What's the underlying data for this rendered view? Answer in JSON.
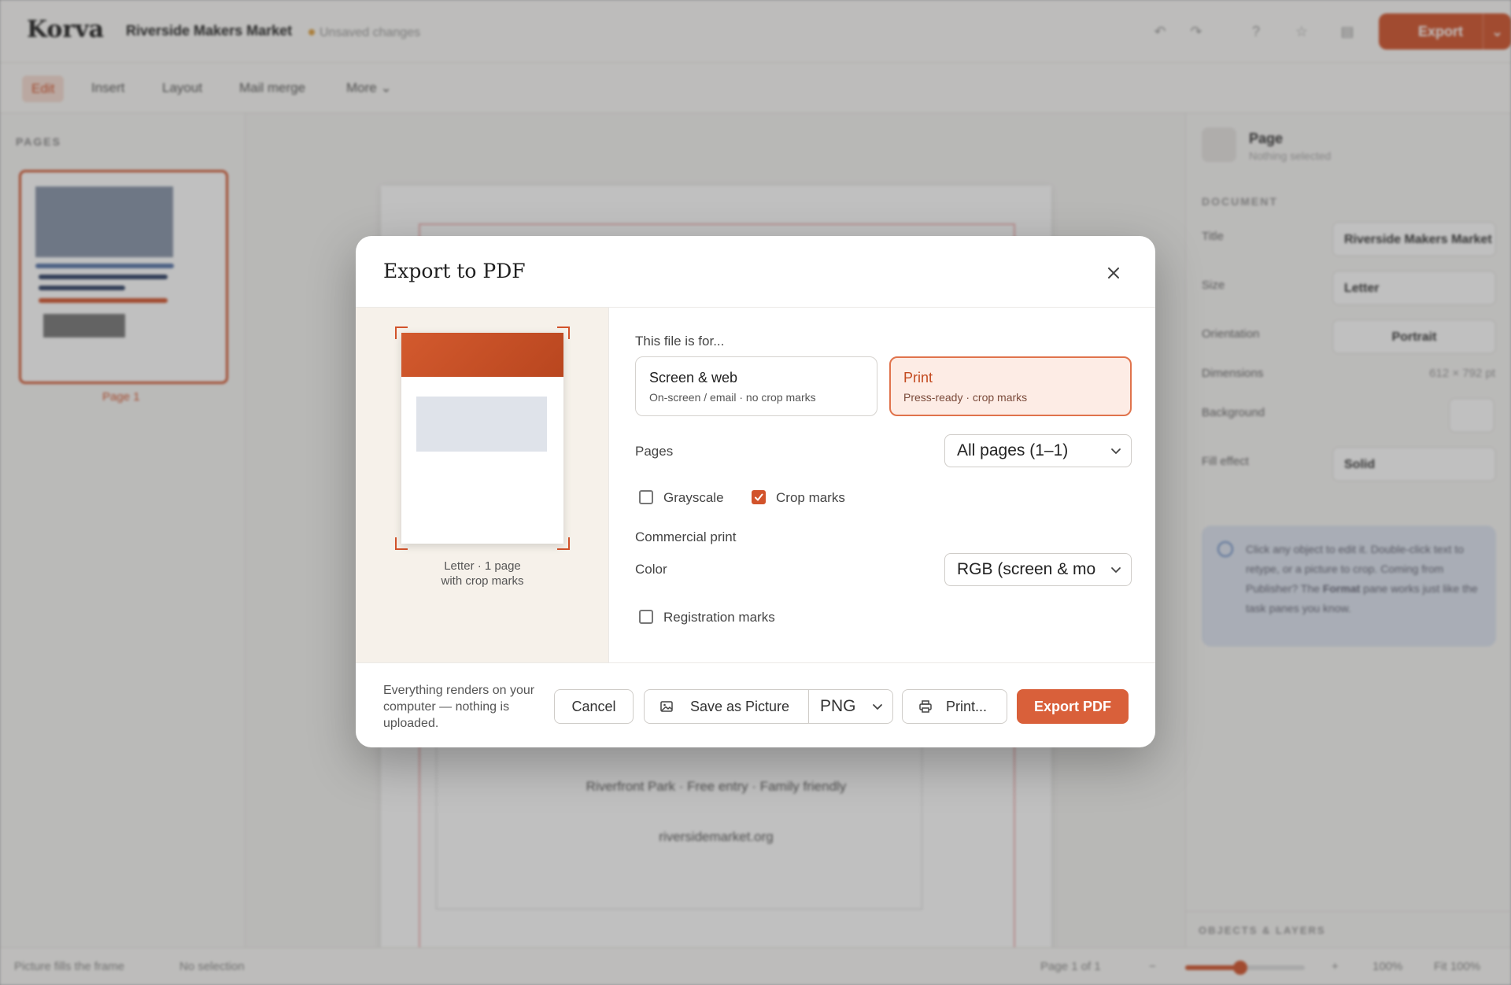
{
  "app": {
    "logo": "Korva",
    "document_title": "Riverside Makers Market",
    "unsaved": "Unsaved changes",
    "export_label": "Export"
  },
  "tabs": [
    {
      "label": "Edit"
    },
    {
      "label": "Insert"
    },
    {
      "label": "Layout"
    },
    {
      "label": "Mail merge"
    },
    {
      "label": "More"
    }
  ],
  "pages_panel": {
    "label": "PAGES",
    "thumb_label": "Page 1"
  },
  "canvas": {
    "line1": "Riverfront Park · Free entry · Family friendly",
    "line2": "riversidemarket.org"
  },
  "right_panel": {
    "title": "Page",
    "subtitle": "Nothing selected",
    "section": "DOCUMENT",
    "fields": {
      "title_label": "Title",
      "title_value": "Riverside Makers Market",
      "size_label": "Size",
      "size_value": "Letter",
      "orientation_label": "Orientation",
      "orientation_value": "Portrait",
      "dimensions_label": "Dimensions",
      "dimensions_value": "612 × 792 pt",
      "background_label": "Background",
      "fill_label": "Fill effect",
      "fill_value": "Solid"
    },
    "hint": {
      "before": "Click any object to edit it. Double-click text to retype, or a picture to crop. Coming from Publisher? The ",
      "bold": "Format",
      "after": " pane works just like the task panes you know."
    },
    "objects_label": "OBJECTS & LAYERS"
  },
  "status_bar": {
    "left": "Picture fills the frame",
    "selection": "No selection",
    "page": "Page 1 of 1",
    "zoom": "100%",
    "zoom_fraction": 0.46,
    "fit": "Fit 100%"
  },
  "dialog": {
    "title": "Export to PDF",
    "preview_caption_1": "Letter · 1 page",
    "preview_caption_2": "with crop marks",
    "purpose_label": "This file is for...",
    "purposes": [
      {
        "title": "Screen & web",
        "subtitle": "On-screen / email · no crop marks",
        "selected": false
      },
      {
        "title": "Print",
        "subtitle": "Press-ready · crop marks",
        "selected": true
      }
    ],
    "pages_label": "Pages",
    "pages_value": "All pages (1–1)",
    "grayscale_label": "Grayscale",
    "grayscale_checked": false,
    "crop_marks_label": "Crop marks",
    "crop_marks_checked": true,
    "commercial_label": "Commercial print",
    "color_label": "Color",
    "color_value": "RGB (screen & mo",
    "registration_label": "Registration marks",
    "registration_checked": false,
    "footer_note": "Everything renders on your computer — nothing is uploaded.",
    "cancel_label": "Cancel",
    "save_picture_label": "Save as Picture",
    "picture_format": "PNG",
    "print_label": "Print...",
    "export_label": "Export PDF"
  },
  "colors": {
    "accent": "#d2532b",
    "accent_soft": "#fdece5",
    "preview_bg": "#f6f1ea"
  },
  "icons": [
    "undo-icon",
    "redo-icon",
    "help-icon",
    "star-icon",
    "save-icon",
    "close-icon",
    "chevron-down-icon",
    "image-icon",
    "printer-icon",
    "check-icon",
    "info-icon"
  ]
}
